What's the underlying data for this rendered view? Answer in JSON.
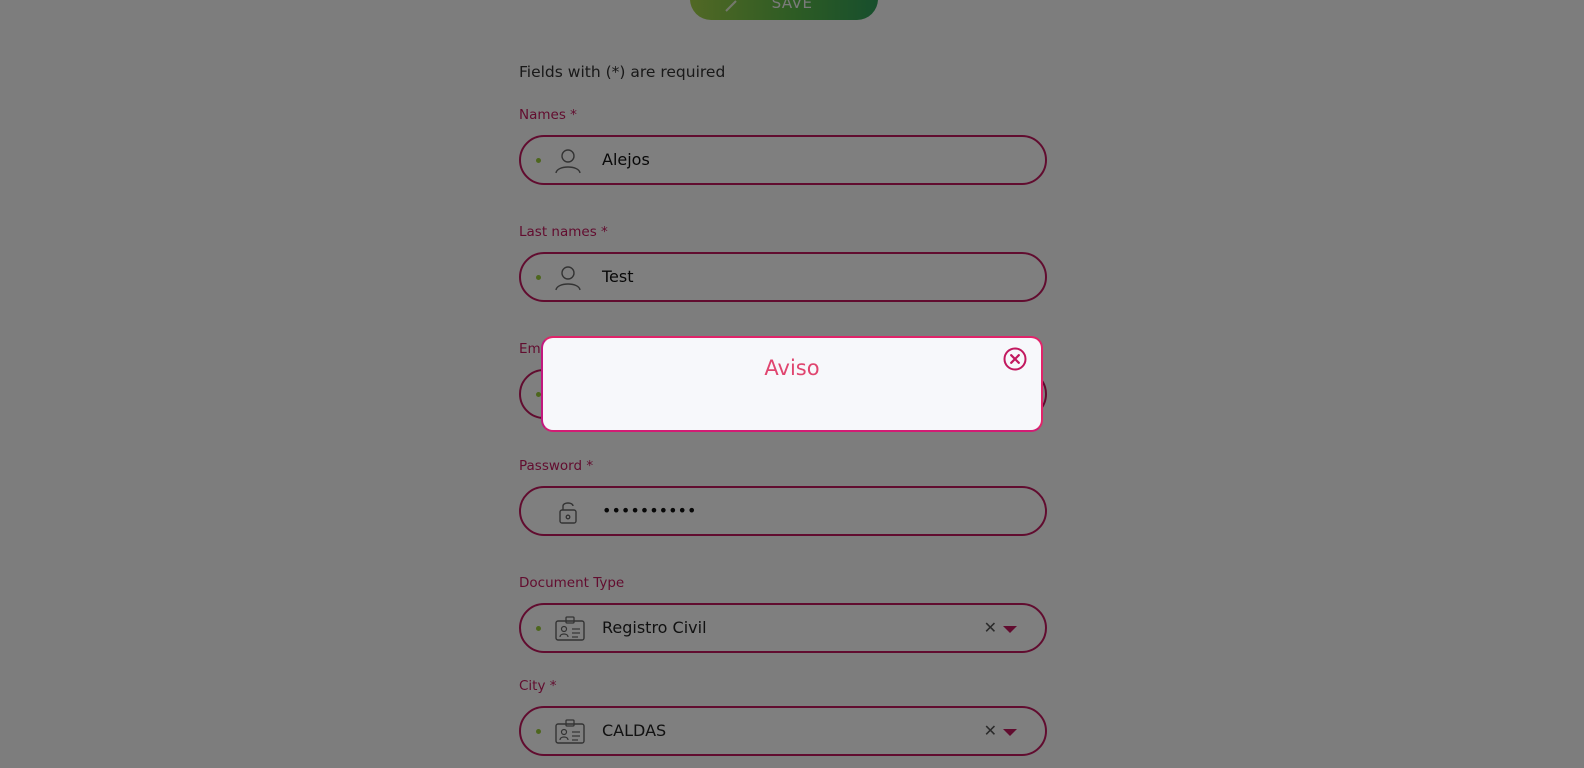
{
  "toolbar": {
    "save_label": "SAVE"
  },
  "form": {
    "required_note": "Fields with (*) are required",
    "fields": {
      "names": {
        "label": "Names *",
        "value": "Alejos"
      },
      "last_names": {
        "label": "Last names *",
        "value": "Test"
      },
      "email": {
        "label": "Em"
      },
      "password": {
        "label": "Password *",
        "value": "••••••••••"
      },
      "document_type": {
        "label": "Document Type",
        "value": "Registro Civil",
        "clear": "✕"
      },
      "city": {
        "label": "City *",
        "value": "CALDAS",
        "clear": "✕"
      }
    }
  },
  "modal": {
    "title": "Aviso"
  },
  "colors": {
    "accent": "#c2195f",
    "modal_title": "#e0456f",
    "dot": "#9bcc3a",
    "save_gradient_start": "#a3d14a",
    "save_gradient_end": "#2f9e5a"
  },
  "icons": {
    "names": "user-icon",
    "last_names": "user-icon",
    "password": "lock-icon",
    "document_type": "id-card-icon",
    "city": "id-card-icon",
    "save": "pencil-icon",
    "close": "close-circle-icon"
  }
}
